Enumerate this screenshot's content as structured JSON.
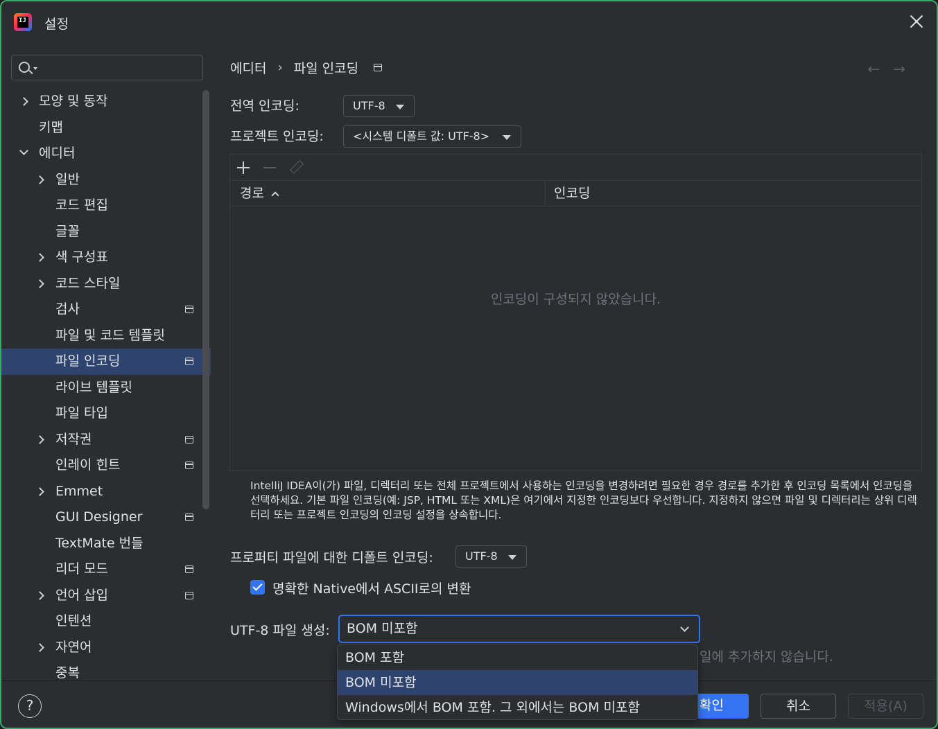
{
  "window": {
    "title": "설정"
  },
  "sidebar": {
    "search_placeholder": "",
    "items": [
      {
        "label": "모양 및 동작",
        "level": 0,
        "chevron": "right",
        "project": false
      },
      {
        "label": "키맵",
        "level": 0,
        "chevron": "none",
        "project": false
      },
      {
        "label": "에디터",
        "level": 0,
        "chevron": "down",
        "project": false
      },
      {
        "label": "일반",
        "level": 1,
        "chevron": "right",
        "project": false
      },
      {
        "label": "코드 편집",
        "level": 1,
        "chevron": "none",
        "project": false
      },
      {
        "label": "글꼴",
        "level": 1,
        "chevron": "none",
        "project": false
      },
      {
        "label": "색 구성표",
        "level": 1,
        "chevron": "right",
        "project": false
      },
      {
        "label": "코드 스타일",
        "level": 1,
        "chevron": "right",
        "project": false
      },
      {
        "label": "검사",
        "level": 1,
        "chevron": "none",
        "project": true
      },
      {
        "label": "파일 및 코드 템플릿",
        "level": 1,
        "chevron": "none",
        "project": false
      },
      {
        "label": "파일 인코딩",
        "level": 1,
        "chevron": "none",
        "project": true,
        "selected": true
      },
      {
        "label": "라이브 템플릿",
        "level": 1,
        "chevron": "none",
        "project": false
      },
      {
        "label": "파일 타입",
        "level": 1,
        "chevron": "none",
        "project": false
      },
      {
        "label": "저작권",
        "level": 1,
        "chevron": "right",
        "project": true
      },
      {
        "label": "인레이 힌트",
        "level": 1,
        "chevron": "none",
        "project": true
      },
      {
        "label": "Emmet",
        "level": 1,
        "chevron": "right",
        "project": false
      },
      {
        "label": "GUI Designer",
        "level": 1,
        "chevron": "none",
        "project": true
      },
      {
        "label": "TextMate 번들",
        "level": 1,
        "chevron": "none",
        "project": false
      },
      {
        "label": "리더 모드",
        "level": 1,
        "chevron": "none",
        "project": true
      },
      {
        "label": "언어 삽입",
        "level": 1,
        "chevron": "right",
        "project": true
      },
      {
        "label": "인텐션",
        "level": 1,
        "chevron": "none",
        "project": false
      },
      {
        "label": "자연어",
        "level": 1,
        "chevron": "right",
        "project": false
      },
      {
        "label": "중복",
        "level": 1,
        "chevron": "none",
        "project": false
      }
    ]
  },
  "breadcrumb": {
    "parent": "에디터",
    "separator": "›",
    "current": "파일 인코딩"
  },
  "nav": {
    "back": "←",
    "forward": "→"
  },
  "global_encoding": {
    "label": "전역 인코딩:",
    "value": "UTF-8"
  },
  "project_encoding": {
    "label": "프로젝트 인코딩:",
    "value": "<시스템 디폴트 값: UTF-8>"
  },
  "table": {
    "columns": [
      "경로",
      "인코딩"
    ],
    "empty_text": "인코딩이 구성되지 않았습니다."
  },
  "description": "IntelliJ IDEA이(가) 파일, 디렉터리 또는 전체 프로젝트에서 사용하는 인코딩을 변경하려면 필요한 경우 경로를 추가한 후 인코딩 목록에서 인코딩을 선택하세요. 기본 파일 인코딩(예: JSP, HTML 또는 XML)은 여기에서 지정한 인코딩보다 우선합니다. 지정하지 않으면 파일 및 디렉터리는 상위 디렉터리 또는 프로젝트 인코딩의 인코딩 설정을 상속합니다.",
  "properties_encoding": {
    "label": "프로퍼티 파일에 대한 디폴트 인코딩:",
    "value": "UTF-8"
  },
  "native_to_ascii": {
    "label": "명확한 Native에서 ASCII로의 변환",
    "checked": true
  },
  "utf8_bom": {
    "label": "UTF-8 파일 생성:",
    "value": "BOM 미포함",
    "hidden_hint": "일에 추가하지 않습니다.",
    "options": [
      "BOM 포함",
      "BOM 미포함",
      "Windows에서 BOM 포함. 그 외에서는 BOM 미포함"
    ],
    "selected_index": 1
  },
  "buttons": {
    "help": "?",
    "ok": "확인",
    "cancel": "취소",
    "apply": "적용(A)"
  },
  "colors": {
    "accent": "#3574f0",
    "selection": "#2e436e",
    "background": "#2b2d30",
    "window_border": "#3fa86b"
  }
}
